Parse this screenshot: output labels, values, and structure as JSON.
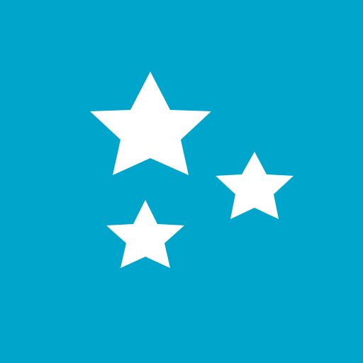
{
  "icon": {
    "name": "stars-icon",
    "background_color": "#00A5CC",
    "foreground_color": "#FFFFFF",
    "star_count": 3
  }
}
